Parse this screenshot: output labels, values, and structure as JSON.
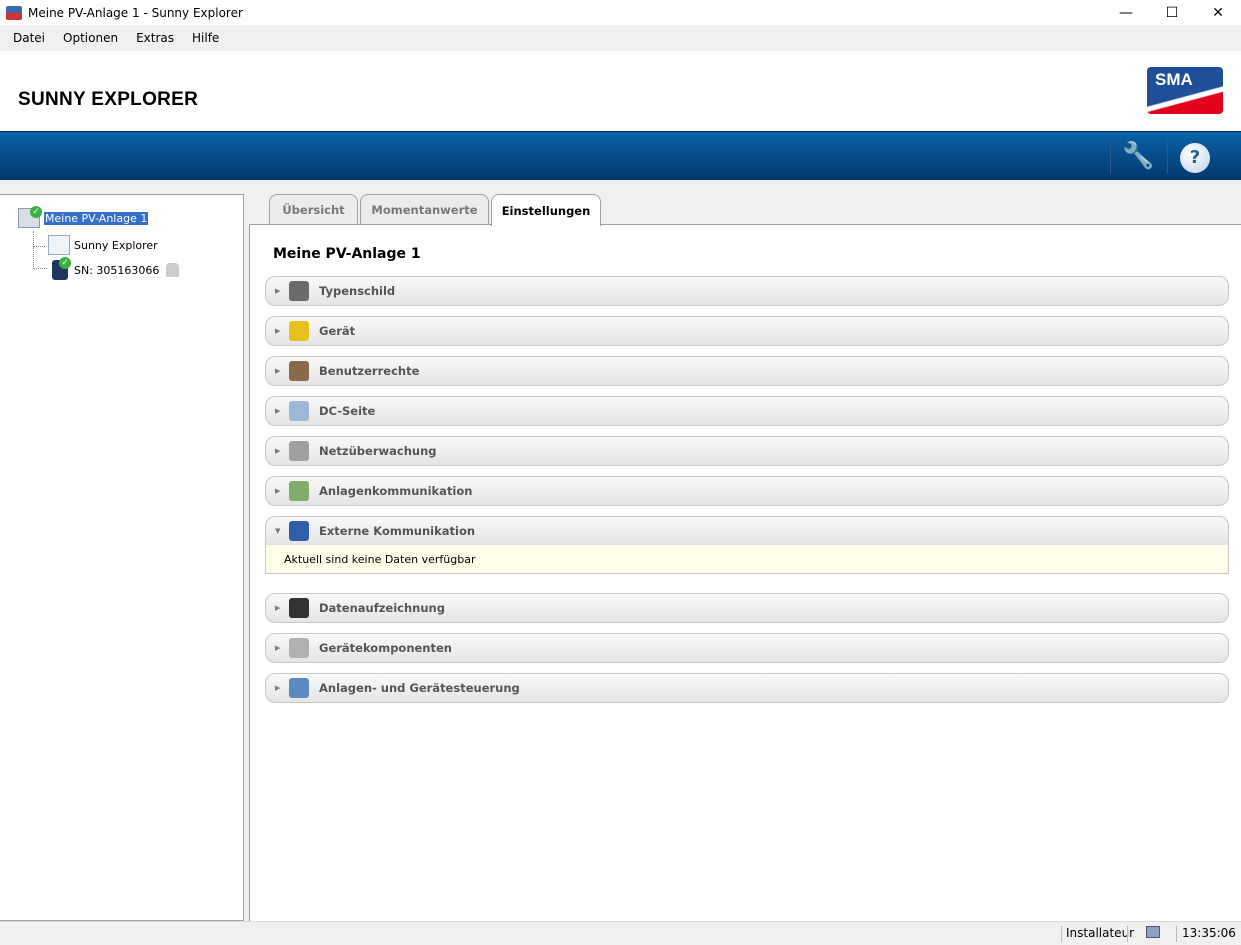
{
  "window": {
    "title": "Meine PV-Anlage 1 - Sunny Explorer",
    "minimize": "—",
    "maximize": "☐",
    "close": "✕"
  },
  "menu": [
    "Datei",
    "Optionen",
    "Extras",
    "Hilfe"
  ],
  "header": {
    "brand": "SUNNY EXPLORER",
    "logo": "SMA",
    "tools_icon": "tools-icon",
    "help": "?"
  },
  "tree": {
    "root": "Meine PV-Anlage 1",
    "children": [
      "Sunny Explorer",
      "SN: 305163066"
    ]
  },
  "tabs": [
    "Übersicht",
    "Momentanwerte",
    "Einstellungen"
  ],
  "active_tab": "Einstellungen",
  "page_title": "Meine PV-Anlage 1",
  "sections": [
    {
      "label": "Typenschild",
      "color": "#6b6b6b"
    },
    {
      "label": "Gerät",
      "color": "#e8c020"
    },
    {
      "label": "Benutzerrechte",
      "color": "#8a6a4a"
    },
    {
      "label": "DC-Seite",
      "color": "#9bb8d8"
    },
    {
      "label": "Netzüberwachung",
      "color": "#a0a0a0"
    },
    {
      "label": "Anlagenkommunikation",
      "color": "#7fae6a"
    },
    {
      "label": "Externe Kommunikation",
      "color": "#2e5fa8",
      "open": true,
      "body": "Aktuell sind keine Daten verfügbar"
    },
    {
      "label": "Datenaufzeichnung",
      "color": "#333333"
    },
    {
      "label": "Gerätekomponenten",
      "color": "#b0b0b0"
    },
    {
      "label": "Anlagen- und Gerätesteuerung",
      "color": "#5a8ac0"
    }
  ],
  "status": {
    "user": "Installateur",
    "time": "13:35:06"
  }
}
